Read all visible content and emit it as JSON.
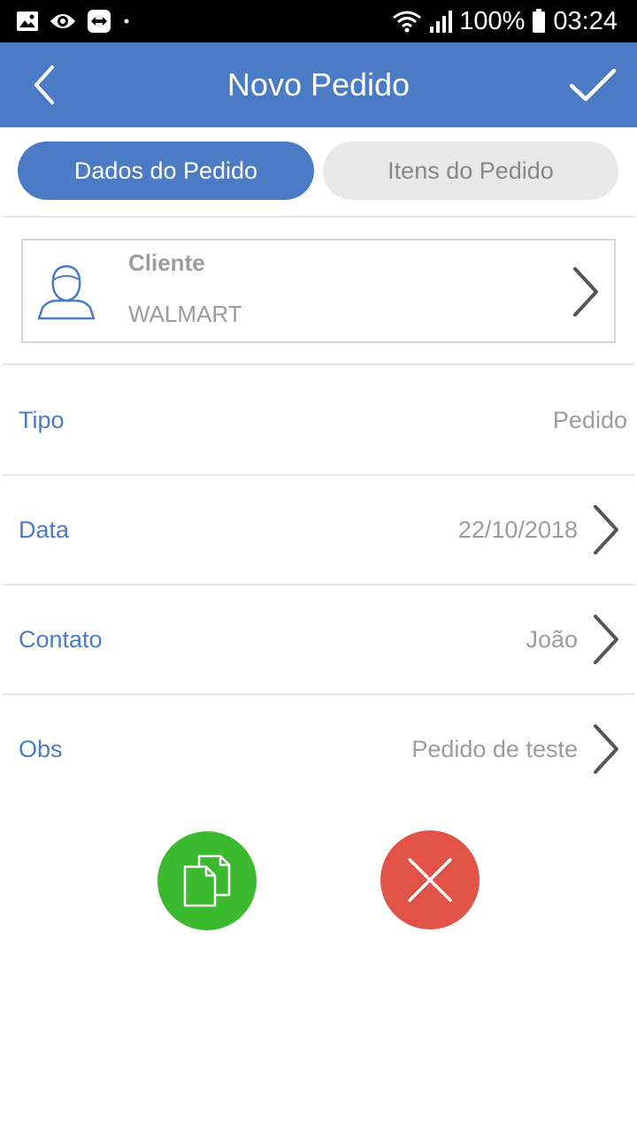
{
  "status_bar": {
    "battery": "100%",
    "time": "03:24",
    "icons": [
      "image-icon",
      "eye-icon",
      "teamviewer-icon",
      "dot-icon",
      "wifi-icon",
      "signal-icon",
      "battery-icon"
    ]
  },
  "app_bar": {
    "title": "Novo Pedido",
    "back_icon": "chevron-left-icon",
    "confirm_icon": "check-icon"
  },
  "tabs": [
    {
      "label": "Dados do Pedido",
      "active": true
    },
    {
      "label": "Itens do Pedido",
      "active": false
    }
  ],
  "client": {
    "label": "Cliente",
    "value": "WALMART",
    "icon": "person-icon"
  },
  "fields": {
    "tipo": {
      "label": "Tipo",
      "value": "Pedido"
    },
    "data": {
      "label": "Data",
      "value": "22/10/2018"
    },
    "contato": {
      "label": "Contato",
      "value": "João"
    },
    "obs": {
      "label": "Obs",
      "value": "Pedido de teste"
    }
  },
  "actions": {
    "copy_icon": "copy-icon",
    "cancel_icon": "close-icon"
  },
  "colors": {
    "primary": "#4a7bc4",
    "copy": "#3cba2f",
    "cancel": "#e05346",
    "muted_text": "#9c9c9c"
  }
}
